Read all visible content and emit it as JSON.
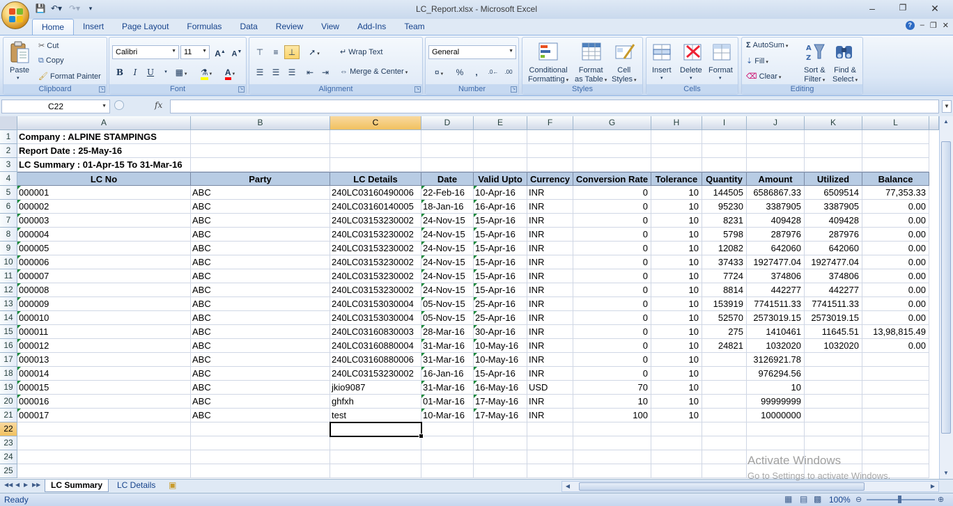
{
  "window": {
    "title": "LC_Report.xlsx - Microsoft Excel"
  },
  "ribbon_tabs": [
    "Home",
    "Insert",
    "Page Layout",
    "Formulas",
    "Data",
    "Review",
    "View",
    "Add-Ins",
    "Team"
  ],
  "ribbon": {
    "clipboard": {
      "label": "Clipboard",
      "paste": "Paste",
      "cut": "Cut",
      "copy": "Copy",
      "format_painter": "Format Painter"
    },
    "font": {
      "label": "Font",
      "name": "Calibri",
      "size": "11"
    },
    "alignment": {
      "label": "Alignment",
      "wrap_text": "Wrap Text",
      "merge_center": "Merge & Center"
    },
    "number": {
      "label": "Number",
      "format": "General"
    },
    "styles": {
      "label": "Styles",
      "conditional_1": "Conditional",
      "conditional_2": "Formatting",
      "format_table_1": "Format",
      "format_table_2": "as Table",
      "cell_styles_1": "Cell",
      "cell_styles_2": "Styles"
    },
    "cells": {
      "label": "Cells",
      "insert": "Insert",
      "delete": "Delete",
      "format": "Format"
    },
    "editing": {
      "label": "Editing",
      "autosum": "AutoSum",
      "fill": "Fill",
      "clear": "Clear",
      "sort_1": "Sort &",
      "sort_2": "Filter",
      "find_1": "Find &",
      "find_2": "Select"
    }
  },
  "formula_bar": {
    "name_box": "C22",
    "fx": "fx",
    "value": ""
  },
  "columns": [
    "A",
    "B",
    "C",
    "D",
    "E",
    "F",
    "G",
    "H",
    "I",
    "J",
    "K",
    "L"
  ],
  "selected_column": "C",
  "selected_row": 22,
  "report": {
    "company": "Company : ALPINE STAMPINGS",
    "report_date": "Report Date : 25-May-16",
    "summary": "LC Summary : 01-Apr-15 To 31-Mar-16"
  },
  "table_headers": [
    "LC No",
    "Party",
    "LC Details",
    "Date",
    "Valid Upto",
    "Currency",
    "Conversion Rate",
    "Tolerance",
    "Quantity",
    "Amount",
    "Utilized",
    "Balance"
  ],
  "rows": [
    [
      "000001",
      "ABC",
      "240LC03160490006",
      "22-Feb-16",
      "10-Apr-16",
      "INR",
      "0",
      "10",
      "144505",
      "6586867.33",
      "6509514",
      "77,353.33"
    ],
    [
      "000002",
      "ABC",
      "240LC03160140005",
      "18-Jan-16",
      "16-Apr-16",
      "INR",
      "0",
      "10",
      "95230",
      "3387905",
      "3387905",
      "0.00"
    ],
    [
      "000003",
      "ABC",
      "240LC03153230002",
      "24-Nov-15",
      "15-Apr-16",
      "INR",
      "0",
      "10",
      "8231",
      "409428",
      "409428",
      "0.00"
    ],
    [
      "000004",
      "ABC",
      "240LC03153230002",
      "24-Nov-15",
      "15-Apr-16",
      "INR",
      "0",
      "10",
      "5798",
      "287976",
      "287976",
      "0.00"
    ],
    [
      "000005",
      "ABC",
      "240LC03153230002",
      "24-Nov-15",
      "15-Apr-16",
      "INR",
      "0",
      "10",
      "12082",
      "642060",
      "642060",
      "0.00"
    ],
    [
      "000006",
      "ABC",
      "240LC03153230002",
      "24-Nov-15",
      "15-Apr-16",
      "INR",
      "0",
      "10",
      "37433",
      "1927477.04",
      "1927477.04",
      "0.00"
    ],
    [
      "000007",
      "ABC",
      "240LC03153230002",
      "24-Nov-15",
      "15-Apr-16",
      "INR",
      "0",
      "10",
      "7724",
      "374806",
      "374806",
      "0.00"
    ],
    [
      "000008",
      "ABC",
      "240LC03153230002",
      "24-Nov-15",
      "15-Apr-16",
      "INR",
      "0",
      "10",
      "8814",
      "442277",
      "442277",
      "0.00"
    ],
    [
      "000009",
      "ABC",
      "240LC03153030004",
      "05-Nov-15",
      "25-Apr-16",
      "INR",
      "0",
      "10",
      "153919",
      "7741511.33",
      "7741511.33",
      "0.00"
    ],
    [
      "000010",
      "ABC",
      "240LC03153030004",
      "05-Nov-15",
      "25-Apr-16",
      "INR",
      "0",
      "10",
      "52570",
      "2573019.15",
      "2573019.15",
      "0.00"
    ],
    [
      "000011",
      "ABC",
      "240LC03160830003",
      "28-Mar-16",
      "30-Apr-16",
      "INR",
      "0",
      "10",
      "275",
      "1410461",
      "11645.51",
      "13,98,815.49"
    ],
    [
      "000012",
      "ABC",
      "240LC03160880004",
      "31-Mar-16",
      "10-May-16",
      "INR",
      "0",
      "10",
      "24821",
      "1032020",
      "1032020",
      "0.00"
    ],
    [
      "000013",
      "ABC",
      "240LC03160880006",
      "31-Mar-16",
      "10-May-16",
      "INR",
      "0",
      "10",
      "",
      "3126921.78",
      "",
      ""
    ],
    [
      "000014",
      "ABC",
      "240LC03153230002",
      "16-Jan-16",
      "15-Apr-16",
      "INR",
      "0",
      "10",
      "",
      "976294.56",
      "",
      ""
    ],
    [
      "000015",
      "ABC",
      "jkio9087",
      "31-Mar-16",
      "16-May-16",
      "USD",
      "70",
      "10",
      "",
      "10",
      "",
      ""
    ],
    [
      "000016",
      "ABC",
      "ghfxh",
      "01-Mar-16",
      "17-May-16",
      "INR",
      "10",
      "10",
      "",
      "99999999",
      "",
      ""
    ],
    [
      "000017",
      "ABC",
      "test",
      "10-Mar-16",
      "17-May-16",
      "INR",
      "100",
      "10",
      "",
      "10000000",
      "",
      ""
    ]
  ],
  "sheet_tabs": [
    "LC Summary",
    "LC Details"
  ],
  "active_sheet": "LC Summary",
  "status": {
    "text": "Ready",
    "zoom": "100%"
  },
  "watermark": {
    "line1": "Activate Windows",
    "line2": "Go to Settings to activate Windows."
  },
  "colors": {
    "header_fill": "#b8cce4",
    "selected_header": "#f1c15f",
    "gridline": "#d0d7e5"
  }
}
